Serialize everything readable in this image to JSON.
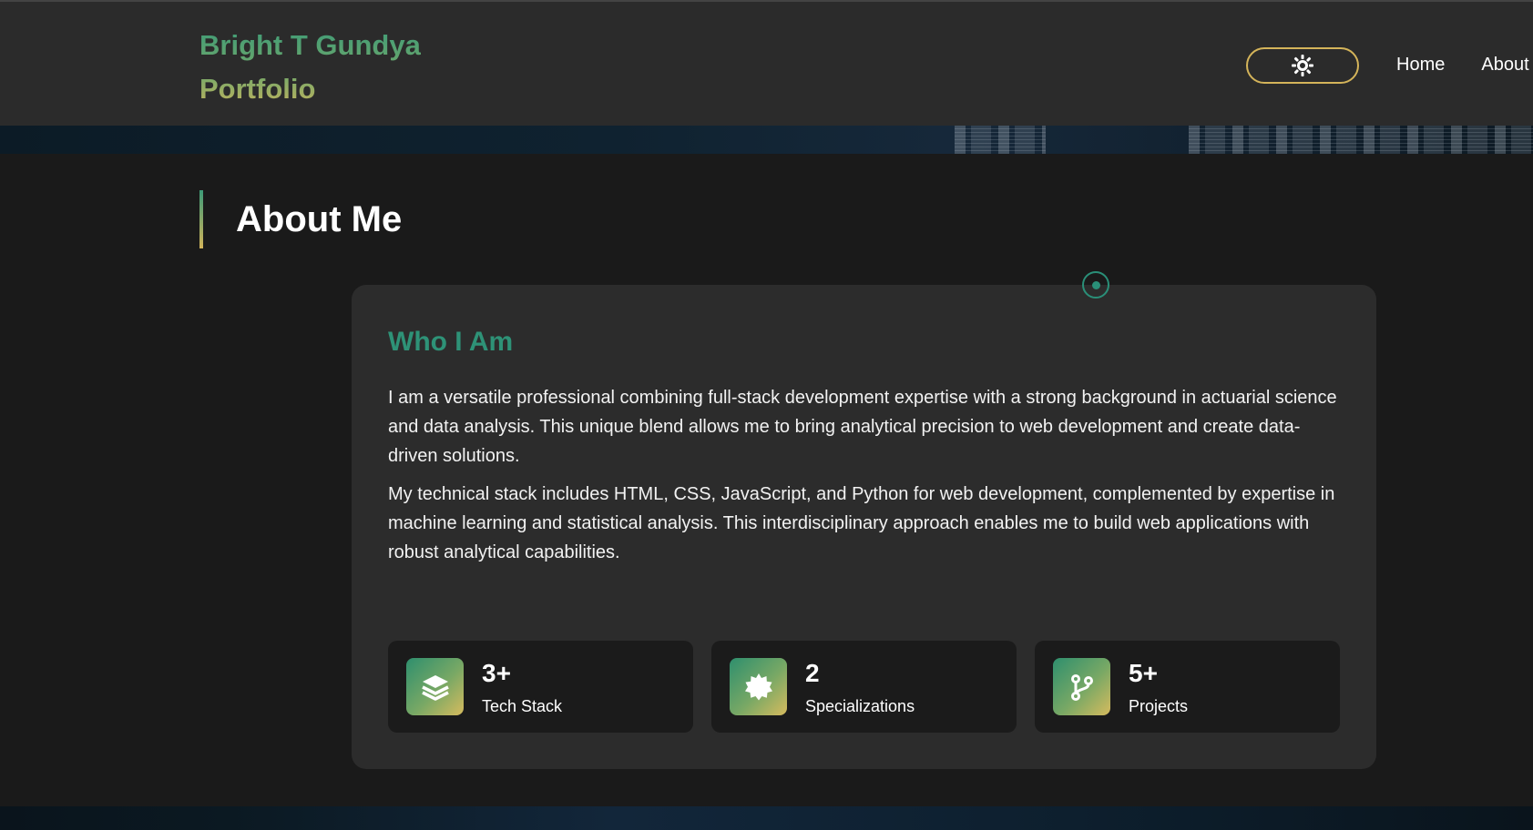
{
  "header": {
    "brand_line1": "Bright T Gundya",
    "brand_line2": "Portfolio",
    "theme_toggle_icon": "sun-icon",
    "nav": [
      {
        "label": "Home"
      },
      {
        "label": "About"
      }
    ]
  },
  "about": {
    "section_title": "About Me",
    "card_title": "Who I Am",
    "paragraph1": "I am a versatile professional combining full-stack development expertise with a strong background in actuarial science and data analysis. This unique blend allows me to bring analytical precision to web development and create data-driven solutions.",
    "paragraph2": "My technical stack includes HTML, CSS, JavaScript, and Python for web development, complemented by expertise in machine learning and statistical analysis. This interdisciplinary approach enables me to build web applications with robust analytical capabilities.",
    "stats": [
      {
        "value": "3+",
        "label": "Tech Stack",
        "icon": "layers-icon"
      },
      {
        "value": "2",
        "label": "Specializations",
        "icon": "badge-icon"
      },
      {
        "value": "5+",
        "label": "Projects",
        "icon": "git-branch-icon"
      }
    ]
  },
  "colors": {
    "accent_green": "#2e9277",
    "accent_gold": "#d4b45a",
    "background": "#1a1a1a",
    "card": "#2c2c2c"
  }
}
